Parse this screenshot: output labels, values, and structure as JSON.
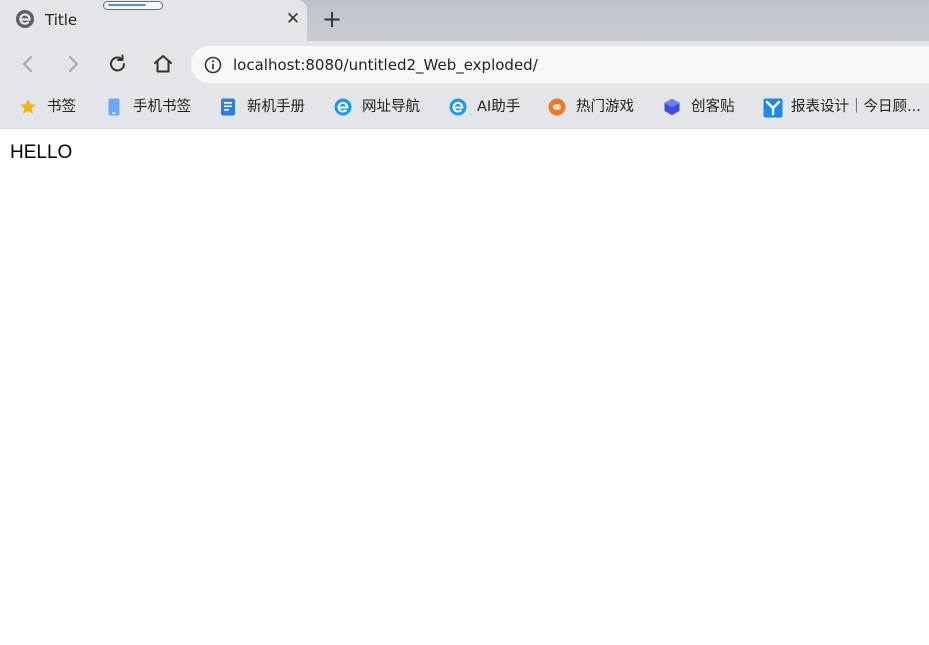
{
  "tab": {
    "title": "Title",
    "close_symbol": "✕",
    "favicon": "browser-e-icon"
  },
  "new_tab_symbol": "+",
  "toolbar": {
    "back_icon": "chevron-left-icon",
    "forward_icon": "chevron-right-icon",
    "reload_icon": "reload-icon",
    "home_icon": "home-icon",
    "url": "localhost:8080/untitled2_Web_exploded/"
  },
  "bookmarks": [
    {
      "label": "书签",
      "icon": "star-icon",
      "color": "#f5b400"
    },
    {
      "label": "手机书签",
      "icon": "phone-icon",
      "color": "#5b9df5"
    },
    {
      "label": "新机手册",
      "icon": "manual-icon",
      "color": "#2f7fe0"
    },
    {
      "label": "网址导航",
      "icon": "browser-e-icon",
      "color": "#1a9be8"
    },
    {
      "label": "AI助手",
      "icon": "browser-e-icon",
      "color": "#1a9be8"
    },
    {
      "label": "热门游戏",
      "icon": "game-icon",
      "color": "#f07a22"
    },
    {
      "label": "创客贴",
      "icon": "chuangke-icon",
      "color": "#3b4fe0"
    },
    {
      "label": "报表设计｜今日顾...",
      "icon": "report-icon",
      "color": "#1e88e5"
    }
  ],
  "page": {
    "text": "HELLO"
  }
}
